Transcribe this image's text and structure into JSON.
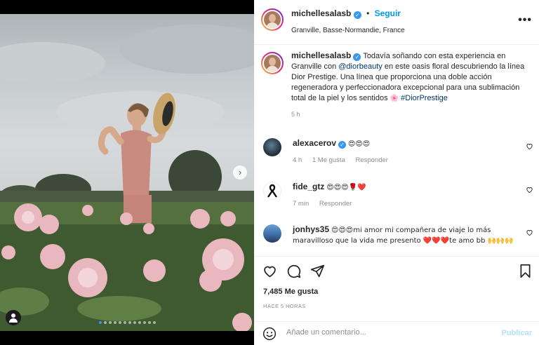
{
  "post": {
    "username": "michellesalasb",
    "separator": "•",
    "follow_label": "Seguir",
    "location": "Granville, Basse-Normandie, France",
    "more_label": "•••",
    "carousel_count": 12,
    "carousel_active": 0
  },
  "caption": {
    "username": "michellesalasb",
    "text_1": "Todavía soñando con esta experiencia en Granville con",
    "mention": "@diorbeauty",
    "text_2": "en este oasis floral descubriendo la línea Dior Prestige. Una línea que proporciona una doble acción regeneradora y perfeccionadora excepcional para una sublimación total de la piel y los sentidos",
    "emoji": "🌸",
    "hashtag": "#DiorPrestige",
    "time": "5 h"
  },
  "comments": [
    {
      "username": "alexacerov",
      "verified": true,
      "text": "😍😍😍",
      "time": "4 h",
      "likes": "1 Me gusta",
      "reply": "Responder"
    },
    {
      "username": "fide_gtz",
      "verified": false,
      "text": "😍😍😍🌹❤️",
      "time": "7 min",
      "reply": "Responder"
    },
    {
      "username": "jonhys35",
      "verified": false,
      "text": "😍😍😍mi amor mi compañera de viaje lo más maravilloso que la vida me presento ❤️❤️❤️te amo bb 🙌🙌🙌"
    }
  ],
  "actions": {
    "likes": "7,485 Me gusta",
    "time_ago": "HACE 5 HORAS"
  },
  "add_comment": {
    "placeholder": "Añade un comentario...",
    "publish_label": "Publicar"
  },
  "icons": [
    "arrow-right-icon",
    "user-tag-icon",
    "verified-badge-icon",
    "more-options-icon",
    "heart-icon",
    "comment-icon",
    "share-icon",
    "bookmark-icon",
    "emoji-icon"
  ],
  "colors": {
    "accent_blue": "#0095f6",
    "link_dark": "#00376b",
    "muted": "#8e8e8e",
    "publish_disabled": "#b2dffc"
  }
}
